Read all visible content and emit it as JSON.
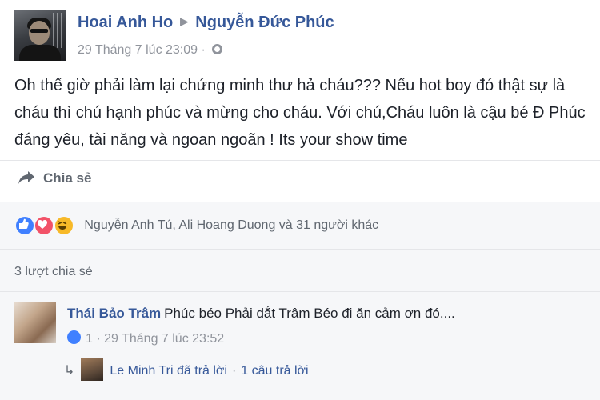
{
  "post": {
    "author": "Hoai Anh Ho",
    "recipient": "Nguyễn Đức Phúc",
    "timestamp": "29 Tháng 7 lúc 23:09",
    "meta_separator": "·",
    "text": "Oh thế giờ phải làm lại chứng minh thư hả cháu??? Nếu hot boy đó thật sự là cháu thì chú hạnh phúc và mừng cho cháu. Với chú,Cháu luôn là cậu bé Đ Phúc đáng yêu, tài năng và ngoan ngoãn ! Its your show time",
    "share_label": "Chia sẻ"
  },
  "feedback": {
    "reactions_text": "Nguyễn Anh Tú, Ali Hoang Duong và 31 người khác",
    "shares_text": "3 lượt chia sẻ"
  },
  "comment": {
    "author": "Thái Bảo Trâm",
    "text": "Phúc béo Phải dắt Trâm Béo đi ăn cảm ơn đó....",
    "likes": "1",
    "timestamp": "29 Tháng 7 lúc 23:52",
    "separator": "·"
  },
  "reply": {
    "name": "Le Minh Tri",
    "action": "đã trả lời",
    "separator": "·",
    "count_label": "1 câu trả lời"
  },
  "icons": {
    "arrow": "triangle-right-icon",
    "privacy": "globe-icon",
    "share": "share-arrow-icon",
    "reactions": [
      "like-icon",
      "love-icon",
      "haha-icon"
    ],
    "reply": "reply-arrow-icon"
  },
  "colors": {
    "link": "#365899",
    "meta": "#90949c",
    "like": "#4080ff",
    "love": "#f25268",
    "haha": "#f7b928"
  }
}
